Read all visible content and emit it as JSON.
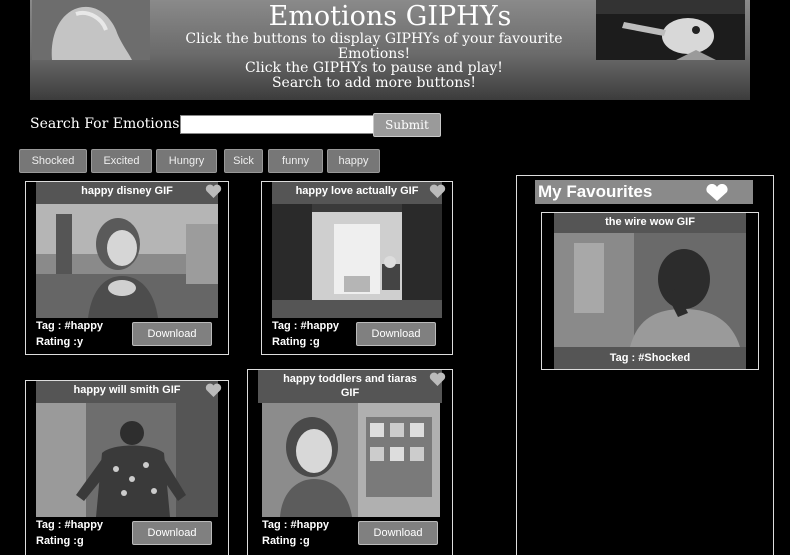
{
  "header": {
    "title": "Emotions GIPHYs",
    "lines": [
      "Click the buttons to display GIPHYs of your favourite",
      "Emotions!",
      "Click the GIPHYs to pause and play!",
      "Search to add more buttons!"
    ]
  },
  "search": {
    "label": "Search For Emotions:",
    "value": "",
    "submit_label": "Submit"
  },
  "emotion_buttons": [
    "Shocked",
    "Excited",
    "Hungry",
    "Sick",
    "funny",
    "happy"
  ],
  "gifs": [
    {
      "title": "happy disney GIF",
      "tag": "Tag : #happy",
      "rating": "Rating :y",
      "download": "Download"
    },
    {
      "title": "happy love actually GIF",
      "tag": "Tag : #happy",
      "rating": "Rating :g",
      "download": "Download"
    },
    {
      "title": "happy will smith GIF",
      "tag": "Tag : #happy",
      "rating": "Rating :g",
      "download": "Download"
    },
    {
      "title": "happy toddlers and tiaras GIF",
      "tag": "Tag : #happy",
      "rating": "Rating :g",
      "download": "Download"
    }
  ],
  "favourites": {
    "title": "My Favourites",
    "items": [
      {
        "title": "the wire wow GIF",
        "tag": "Tag : #Shocked"
      }
    ]
  },
  "icons": {
    "heart": "heart-icon"
  },
  "colors": {
    "background": "#000000",
    "button": "#808080",
    "card_border": "#dddddd"
  }
}
